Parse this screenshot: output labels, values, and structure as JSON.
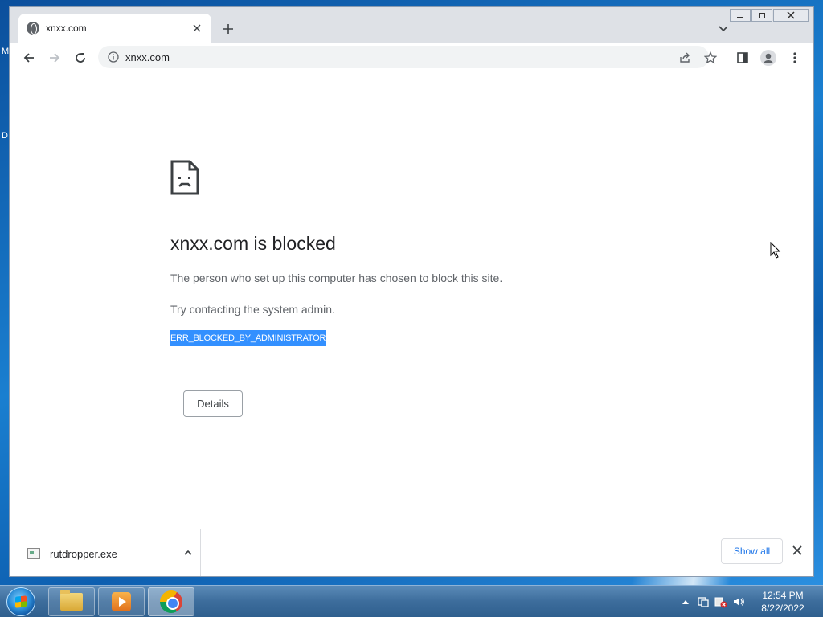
{
  "desktop": {
    "edge_letter_1": "M",
    "edge_letter_2": "D"
  },
  "browser": {
    "tab": {
      "title": "xnxx.com",
      "close_icon": "close-icon"
    },
    "new_tab_icon": "+",
    "omnibox": {
      "url": "xnxx.com"
    }
  },
  "error_page": {
    "title": "xnxx.com is blocked",
    "description": "The person who set up this computer has chosen to block this site.",
    "suggestion": "Try contacting the system admin.",
    "error_code": "ERR_BLOCKED_BY_ADMINISTRATOR",
    "details_label": "Details"
  },
  "download_shelf": {
    "file_name": "rutdropper.exe",
    "show_all_label": "Show all"
  },
  "taskbar": {
    "time": "12:54 PM",
    "date": "8/22/2022"
  },
  "colors": {
    "selection": "#3390ff",
    "link": "#1a73e8",
    "title_text": "#202124",
    "secondary_text": "#5f6368"
  }
}
